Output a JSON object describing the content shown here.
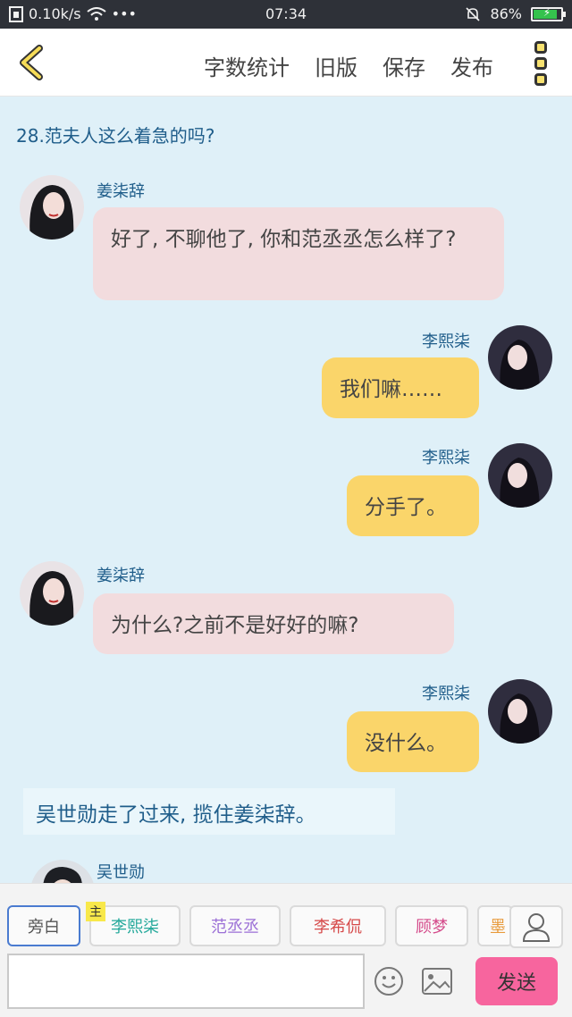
{
  "status_bar": {
    "speed": "0.10k/s",
    "dots": "•••",
    "time": "07:34",
    "battery": "86%",
    "battery_level": 0.86
  },
  "header": {
    "menu": [
      "字数统计",
      "旧版",
      "保存",
      "发布"
    ]
  },
  "chat": {
    "top_narration": "28.范夫人这么着急的吗?",
    "messages": [
      {
        "speaker": "姜柒辞",
        "text": "好了, 不聊他了, 你和范丞丞怎么样了?"
      },
      {
        "speaker": "李熙柒",
        "text": "我们嘛……"
      },
      {
        "speaker": "李熙柒",
        "text": "分手了。"
      },
      {
        "speaker": "姜柒辞",
        "text": "为什么?之前不是好好的嘛?"
      },
      {
        "speaker": "李熙柒",
        "text": "没什么。"
      }
    ],
    "narration": "吴世勋走了过来, 揽住姜柒辞。",
    "next_speaker": "吴世勋"
  },
  "bottom": {
    "roles": [
      {
        "label": "旁白",
        "color": "#555555"
      },
      {
        "label": "李熙柒",
        "color": "#22a89a"
      },
      {
        "label": "范丞丞",
        "color": "#9b6fd6"
      },
      {
        "label": "李希侃",
        "color": "#d64a4a"
      },
      {
        "label": "顾梦",
        "color": "#d44a8a"
      },
      {
        "label": "墨",
        "color": "#e89a3a"
      }
    ],
    "main_tag": "主",
    "send": "发送"
  }
}
